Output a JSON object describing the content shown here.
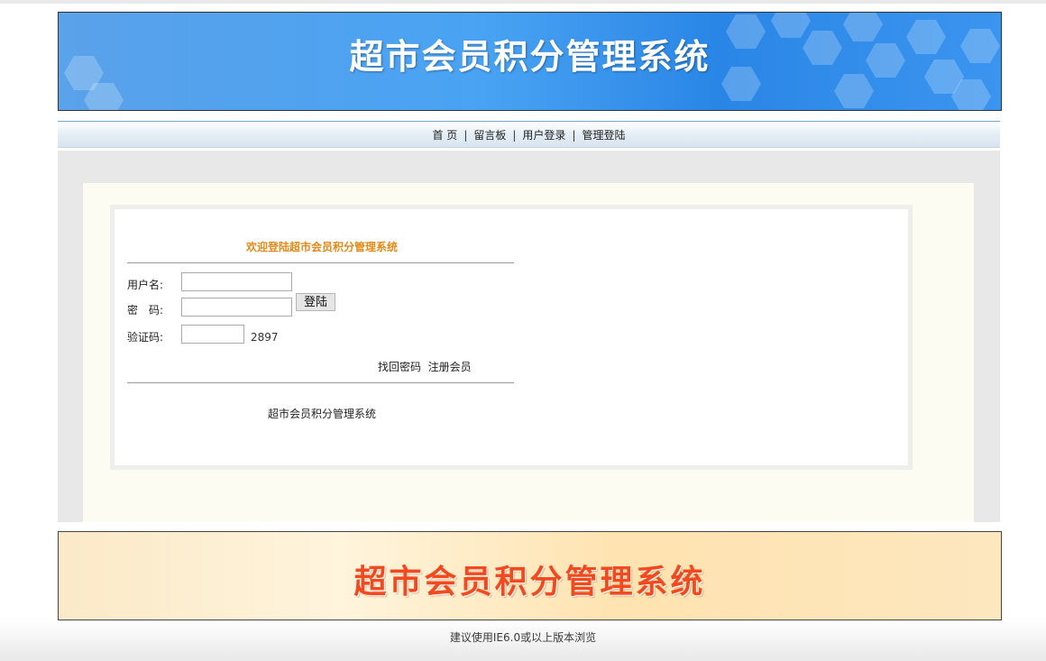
{
  "header": {
    "title": "超市会员积分管理系统"
  },
  "nav": {
    "items": [
      "首 页",
      "留言板",
      "用户登录",
      "管理登陆"
    ],
    "separator": "|"
  },
  "login": {
    "welcome": "欢迎登陆超市会员积分管理系统",
    "username_label": "用户名:",
    "password_label": "密　码:",
    "captcha_label": "验证码:",
    "username_value": "",
    "password_value": "",
    "captcha_value": "",
    "login_button": "登陆",
    "captcha_code": "2897",
    "forgot_link": "找回密码",
    "register_link": "注册会员",
    "system_name": "超市会员积分管理系统"
  },
  "footer": {
    "title": "超市会员积分管理系统",
    "copyright": "建议使用IE6.0或以上版本浏览"
  },
  "colors": {
    "header_bg": "#49a3f3",
    "welcome_text": "#e08a1a",
    "footer_title": "#f04a1e"
  }
}
